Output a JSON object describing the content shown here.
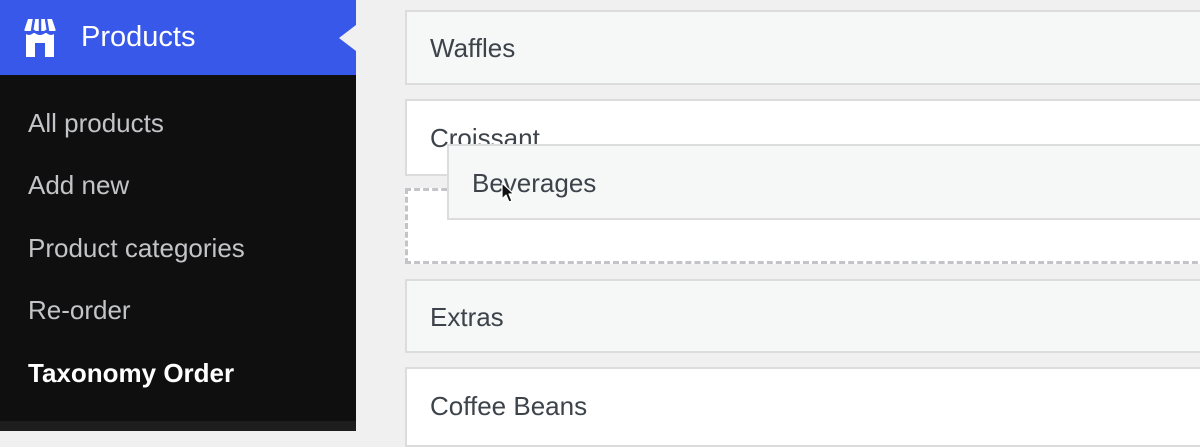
{
  "sidebar": {
    "header": {
      "title": "Products",
      "icon": "store-icon"
    },
    "submenu": [
      {
        "label": "All products"
      },
      {
        "label": "Add new"
      },
      {
        "label": "Product categories"
      },
      {
        "label": "Re-order"
      },
      {
        "label": "Taxonomy Order",
        "current": true
      }
    ]
  },
  "terms": {
    "waffles": "Waffles",
    "croissant": "Croissant",
    "dragging": "Beverages",
    "extras": "Extras",
    "coffee_beans": "Coffee Beans"
  },
  "colors": {
    "admin_blue": "#3858e9",
    "sidebar_bg": "#0f0f0f",
    "content_bg": "#f0f0f1"
  }
}
